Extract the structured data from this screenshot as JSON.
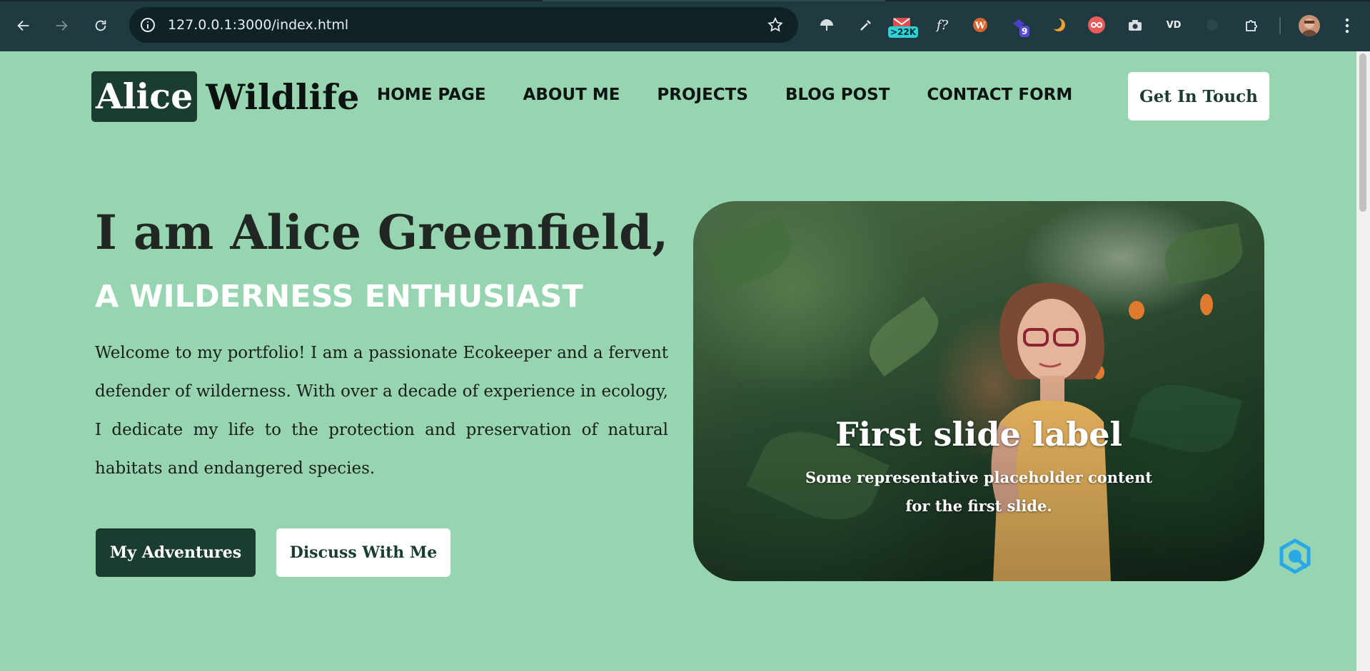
{
  "browser": {
    "url": "127.0.0.1:3000/index.html",
    "extension_badges": [
      ">22K",
      "9"
    ],
    "extension_glyph_f": "f?",
    "extension_glyph_vd": "VD"
  },
  "nav": {
    "logo_part1": "Alice",
    "logo_part2": "Wildlife",
    "menu": [
      "HOME PAGE",
      "ABOUT ME",
      "PROJECTS",
      "BLOG POST",
      "CONTACT FORM"
    ],
    "cta": "Get In Touch"
  },
  "hero": {
    "title": "I am Alice Greenfield,",
    "subtitle": "A WILDERNESS ENTHUSIAST",
    "intro": "Welcome to my portfolio! I am a passionate Ecokeeper and a fervent defender of wilderness. With over a decade of experience in ecology, I dedicate my life to the protection and preservation of natural habitats and endangered species.",
    "primary_button": "My Adventures",
    "secondary_button": "Discuss With Me"
  },
  "carousel": {
    "slide_label": "First slide label",
    "slide_text": "Some representative placeholder content for the first slide."
  },
  "colors": {
    "page_bg": "#97d5b0",
    "brand_dark": "#1b3d2f",
    "chrome_bg": "#1f3a40"
  }
}
